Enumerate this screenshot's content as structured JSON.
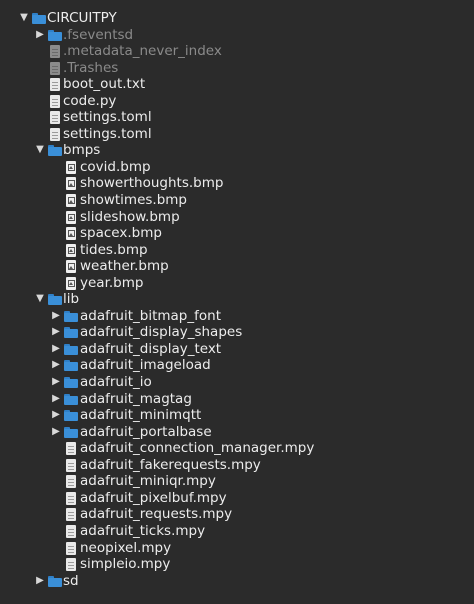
{
  "window": {
    "background": "#2b2b2b",
    "folder_color": "#3a8fd8"
  },
  "tree": [
    {
      "label": "CIRCUITPY",
      "level": 0,
      "kind": "folder",
      "state": "expanded"
    },
    {
      "label": ".fseventsd",
      "level": 1,
      "kind": "folder",
      "state": "collapsed",
      "dim": true
    },
    {
      "label": ".metadata_never_index",
      "level": 1,
      "kind": "file",
      "dim": true
    },
    {
      "label": ".Trashes",
      "level": 1,
      "kind": "file",
      "dim": true
    },
    {
      "label": "boot_out.txt",
      "level": 1,
      "kind": "file"
    },
    {
      "label": "code.py",
      "level": 1,
      "kind": "file"
    },
    {
      "label": "settings.toml",
      "level": 1,
      "kind": "file"
    },
    {
      "label": "settings.toml",
      "level": 1,
      "kind": "file"
    },
    {
      "label": "bmps",
      "level": 1,
      "kind": "folder",
      "state": "expanded"
    },
    {
      "label": "covid.bmp",
      "level": 2,
      "kind": "image"
    },
    {
      "label": "showerthoughts.bmp",
      "level": 2,
      "kind": "image"
    },
    {
      "label": "showtimes.bmp",
      "level": 2,
      "kind": "image"
    },
    {
      "label": "slideshow.bmp",
      "level": 2,
      "kind": "image"
    },
    {
      "label": "spacex.bmp",
      "level": 2,
      "kind": "image"
    },
    {
      "label": "tides.bmp",
      "level": 2,
      "kind": "image"
    },
    {
      "label": "weather.bmp",
      "level": 2,
      "kind": "image"
    },
    {
      "label": "year.bmp",
      "level": 2,
      "kind": "image"
    },
    {
      "label": "lib",
      "level": 1,
      "kind": "folder",
      "state": "expanded"
    },
    {
      "label": "adafruit_bitmap_font",
      "level": 2,
      "kind": "folder",
      "state": "collapsed"
    },
    {
      "label": "adafruit_display_shapes",
      "level": 2,
      "kind": "folder",
      "state": "collapsed"
    },
    {
      "label": "adafruit_display_text",
      "level": 2,
      "kind": "folder",
      "state": "collapsed"
    },
    {
      "label": "adafruit_imageload",
      "level": 2,
      "kind": "folder",
      "state": "collapsed"
    },
    {
      "label": "adafruit_io",
      "level": 2,
      "kind": "folder",
      "state": "collapsed"
    },
    {
      "label": "adafruit_magtag",
      "level": 2,
      "kind": "folder",
      "state": "collapsed"
    },
    {
      "label": "adafruit_minimqtt",
      "level": 2,
      "kind": "folder",
      "state": "collapsed"
    },
    {
      "label": "adafruit_portalbase",
      "level": 2,
      "kind": "folder",
      "state": "collapsed"
    },
    {
      "label": "adafruit_connection_manager.mpy",
      "level": 2,
      "kind": "file"
    },
    {
      "label": "adafruit_fakerequests.mpy",
      "level": 2,
      "kind": "file"
    },
    {
      "label": "adafruit_miniqr.mpy",
      "level": 2,
      "kind": "file"
    },
    {
      "label": "adafruit_pixelbuf.mpy",
      "level": 2,
      "kind": "file"
    },
    {
      "label": "adafruit_requests.mpy",
      "level": 2,
      "kind": "file"
    },
    {
      "label": "adafruit_ticks.mpy",
      "level": 2,
      "kind": "file"
    },
    {
      "label": "neopixel.mpy",
      "level": 2,
      "kind": "file"
    },
    {
      "label": "simpleio.mpy",
      "level": 2,
      "kind": "file"
    },
    {
      "label": "sd",
      "level": 1,
      "kind": "folder",
      "state": "collapsed"
    }
  ]
}
